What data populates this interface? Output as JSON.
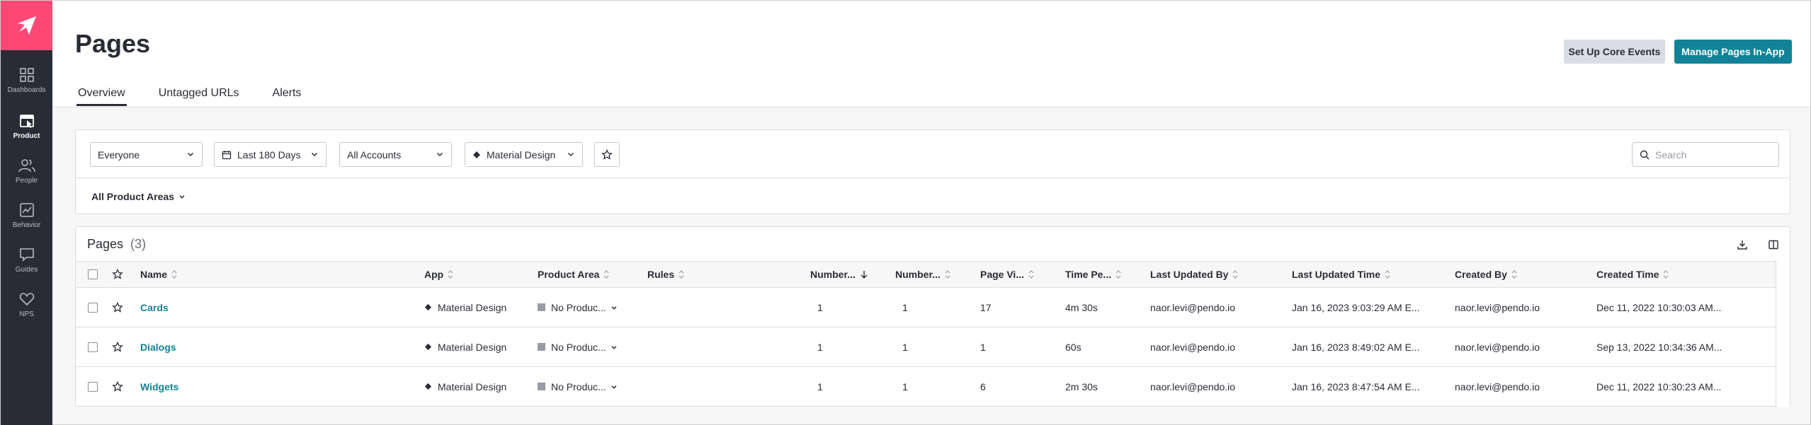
{
  "sidebar": {
    "logo": "pendo-logo",
    "items": [
      {
        "label": "Dashboards",
        "icon": "grid-icon"
      },
      {
        "label": "Product",
        "icon": "product-icon",
        "active": true
      },
      {
        "label": "People",
        "icon": "people-icon"
      },
      {
        "label": "Behavior",
        "icon": "chart-icon"
      },
      {
        "label": "Guides",
        "icon": "message-icon"
      },
      {
        "label": "NPS",
        "icon": "heart-icon"
      }
    ]
  },
  "header": {
    "title": "Pages",
    "setup_button": "Set Up Core Events",
    "manage_button": "Manage Pages In-App",
    "tabs": [
      "Overview",
      "Untagged URLs",
      "Alerts"
    ],
    "active_tab": "Overview"
  },
  "filters": {
    "segment": "Everyone",
    "date_range": "Last 180 Days",
    "accounts": "All Accounts",
    "app": "Material Design",
    "search_placeholder": "Search",
    "product_areas": "All Product Areas"
  },
  "table": {
    "title": "Pages",
    "count": "(3)",
    "columns": [
      "Name",
      "App",
      "Product Area",
      "Rules",
      "Number...",
      "Number...",
      "Page Vi...",
      "Time Pe...",
      "Last Updated By",
      "Last Updated Time",
      "Created By",
      "Created Time"
    ],
    "rows": [
      {
        "name": "Cards",
        "app": "Material Design",
        "product_area": "No Produc...",
        "rules": "",
        "num1": "1",
        "num2": "1",
        "page_views": "17",
        "time_per": "4m 30s",
        "last_updated_by": "naor.levi@pendo.io",
        "last_updated_time": "Jan 16, 2023 9:03:29 AM E...",
        "created_by": "naor.levi@pendo.io",
        "created_time": "Dec 11, 2022 10:30:03 AM..."
      },
      {
        "name": "Dialogs",
        "app": "Material Design",
        "product_area": "No Produc...",
        "rules": "",
        "num1": "1",
        "num2": "1",
        "page_views": "1",
        "time_per": "60s",
        "last_updated_by": "naor.levi@pendo.io",
        "last_updated_time": "Jan 16, 2023 8:49:02 AM E...",
        "created_by": "naor.levi@pendo.io",
        "created_time": "Sep 13, 2022 10:34:36 AM..."
      },
      {
        "name": "Widgets",
        "app": "Material Design",
        "product_area": "No Produc...",
        "rules": "",
        "num1": "1",
        "num2": "1",
        "page_views": "6",
        "time_per": "2m 30s",
        "last_updated_by": "naor.levi@pendo.io",
        "last_updated_time": "Jan 16, 2023 8:47:54 AM E...",
        "created_by": "naor.levi@pendo.io",
        "created_time": "Dec 11, 2022 10:30:23 AM..."
      }
    ]
  },
  "colors": {
    "sidebar_bg": "#2a2c35",
    "logo_bg": "#ff4876",
    "primary": "#128297",
    "link": "#128297"
  }
}
